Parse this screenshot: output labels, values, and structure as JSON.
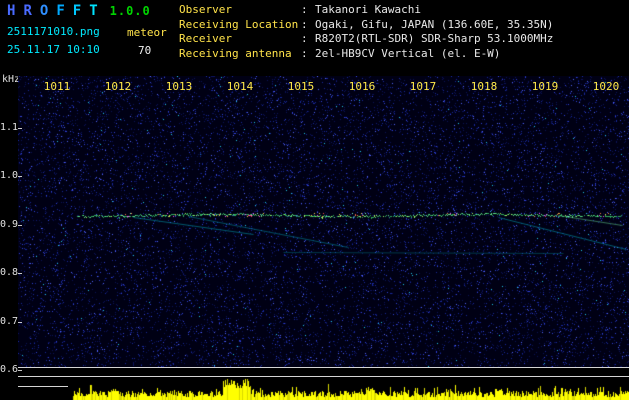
{
  "header": {
    "title_letters": [
      {
        "ch": "H",
        "color": "#4a6bff"
      },
      {
        "ch": "R",
        "color": "#4a6bff"
      },
      {
        "ch": "O",
        "color": "#2f8fff"
      },
      {
        "ch": "F",
        "color": "#00aaff"
      },
      {
        "ch": "F",
        "color": "#00c8ff"
      },
      {
        "ch": "T",
        "color": "#00e4ff"
      }
    ],
    "version": "1.0.0",
    "filename": "2511171010.png",
    "mode": "meteor",
    "datetime": "25.11.17 10:10",
    "count": "70",
    "info": [
      {
        "label": "Observer",
        "value": "Takanori Kawachi"
      },
      {
        "label": "Receiving Location",
        "value": "Ogaki, Gifu, JAPAN (136.60E, 35.35N)"
      },
      {
        "label": "Receiver",
        "value": "R820T2(RTL-SDR) SDR-Sharp 53.1000MHz"
      },
      {
        "label": "Receiving antenna",
        "value": "2el-HB9CV Vertical (el. E-W)"
      }
    ]
  },
  "spectrogram": {
    "y_unit": "kHz",
    "y_ticks": [
      "1.1",
      "1.0",
      "0.9",
      "0.8",
      "0.7",
      "0.6"
    ],
    "x_ticks": [
      "1011",
      "1012",
      "1013",
      "1014",
      "1015",
      "1016",
      "1017",
      "1018",
      "1019",
      "1020"
    ],
    "echo_trace_khz": 0.92,
    "colors": {
      "noise_bg": "#000014",
      "noise_blue": "#2a3ac0",
      "trace_green": "#3fbe6a",
      "tick_yellow": "#ffe94a",
      "level_bar_yellow": "#ffff00"
    }
  }
}
